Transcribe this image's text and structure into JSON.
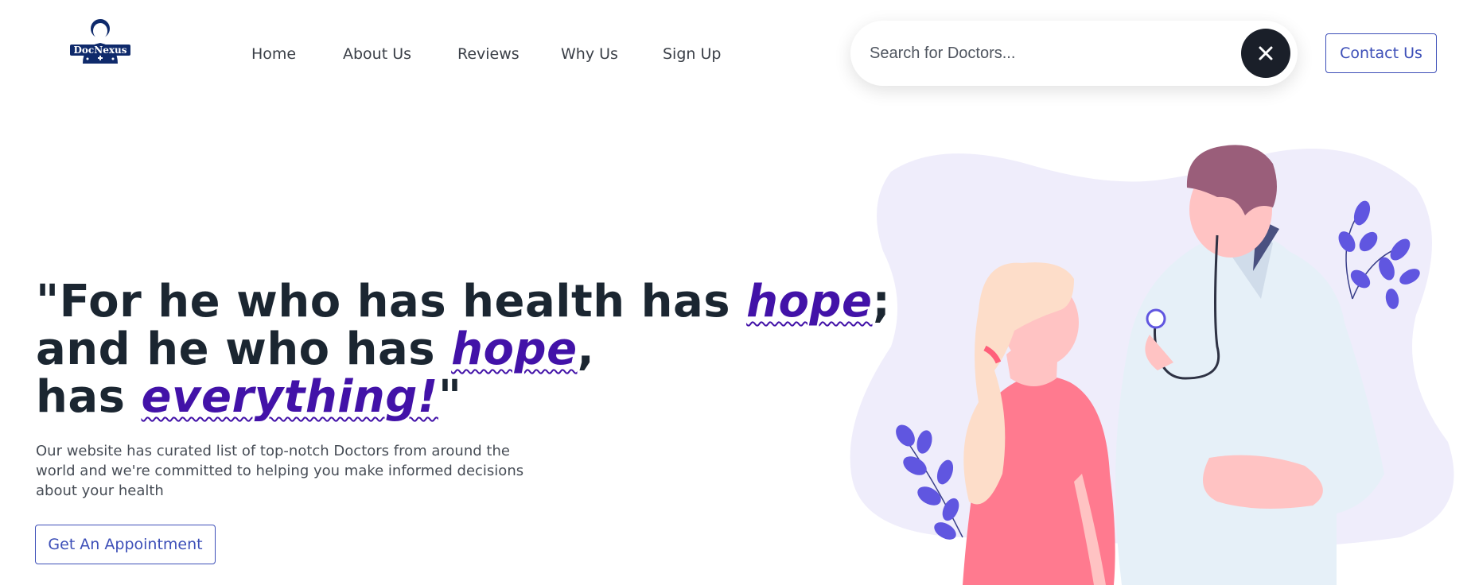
{
  "brand": {
    "logo_text": "DocNexus",
    "logo_icon": "doctor-avatar-icon"
  },
  "nav": {
    "items": [
      {
        "label": "Home"
      },
      {
        "label": "About Us"
      },
      {
        "label": "Reviews"
      },
      {
        "label": "Why Us"
      },
      {
        "label": "Sign Up"
      }
    ]
  },
  "search": {
    "placeholder": "Search for Doctors...",
    "value": "",
    "close_icon": "close-icon"
  },
  "header": {
    "contact_label": "Contact Us"
  },
  "hero": {
    "line1_a": "\"For he who has health has ",
    "line1_hl": "hope",
    "line1_b": ";",
    "line2_a": "and he who has ",
    "line2_hl": "hope",
    "line2_b": ",",
    "line3_a": "has ",
    "line3_hl": "everything!",
    "line3_b": "\"",
    "subtext": "Our website has curated list of top-notch Doctors from around the world and we're committed to helping you make informed decisions about your health",
    "cta_label": "Get An Appointment"
  },
  "colors": {
    "accent": "#3d4fb8",
    "highlight": "#4212a8",
    "heading": "#1b2631",
    "blob": "#efedfb",
    "leaves": "#6056e0"
  }
}
